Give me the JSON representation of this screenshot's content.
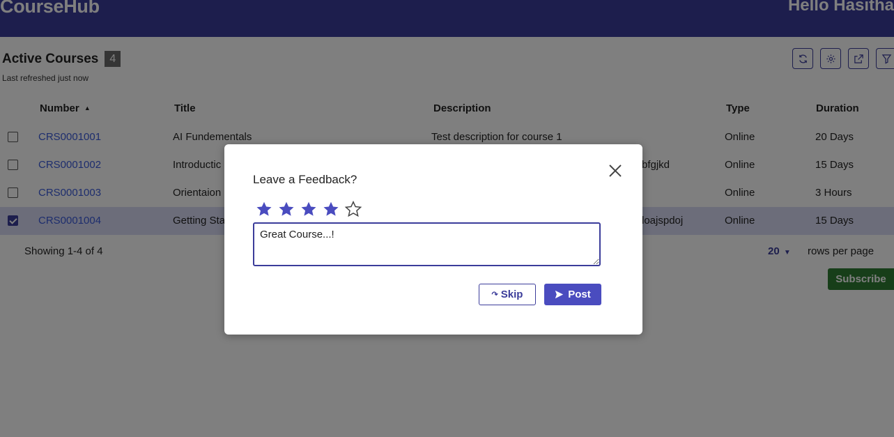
{
  "header": {
    "brand": "CourseHub",
    "greeting": "Hello Hasitha"
  },
  "page": {
    "title": "Active Courses",
    "count": "4",
    "refreshed": "Last refreshed just now"
  },
  "toolbar": {
    "icons": [
      "refresh-icon",
      "gear-icon",
      "export-icon",
      "filter-icon"
    ]
  },
  "table": {
    "columns": [
      "Number",
      "Title",
      "Description",
      "Type",
      "Duration"
    ],
    "sort_column": "Number",
    "sort_direction": "ascending",
    "rows": [
      {
        "number": "CRS0001001",
        "title": "AI Fundementals",
        "description": "Test description for course 1",
        "type": "Online",
        "duration": "20 Days",
        "selected": false
      },
      {
        "number": "CRS0001002",
        "title": "Introductic",
        "description": "bfgjkd",
        "type": "Online",
        "duration": "15 Days",
        "selected": false
      },
      {
        "number": "CRS0001003",
        "title": "Orientaion",
        "description": "",
        "type": "Online",
        "duration": "3 Hours",
        "selected": false
      },
      {
        "number": "CRS0001004",
        "title": "Getting Sta",
        "description": "loajspdoj",
        "type": "Online",
        "duration": "15 Days",
        "selected": true
      }
    ]
  },
  "footer": {
    "showing": "Showing 1-4 of 4",
    "per_page": "20",
    "rows_per_page_label": "rows per page",
    "subscribe_label": "Subscribe"
  },
  "modal": {
    "title": "Leave a Feedback?",
    "rating": 4,
    "rating_max": 5,
    "feedback_text": "Great Course...!",
    "skip_label": "Skip",
    "post_label": "Post"
  },
  "colors": {
    "brand": "#3b3c9a",
    "link": "#3b5bdb",
    "subscribe": "#2e7d32",
    "selected_row": "#d8daf4"
  }
}
